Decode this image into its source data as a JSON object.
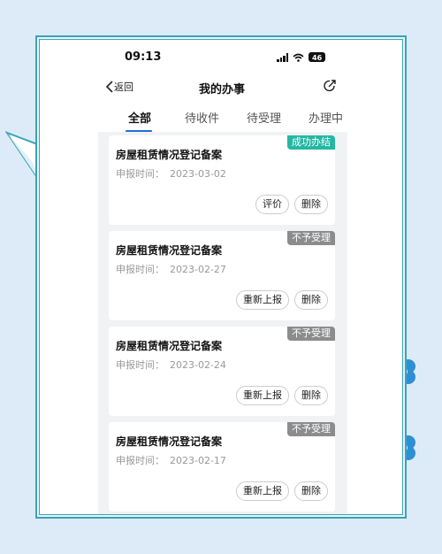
{
  "statusbar": {
    "time": "09:13",
    "battery": "46"
  },
  "navbar": {
    "back_label": "返回",
    "title": "我的办事"
  },
  "tabs": [
    {
      "label": "全部",
      "active": true
    },
    {
      "label": "待收件",
      "active": false
    },
    {
      "label": "待受理",
      "active": false
    },
    {
      "label": "办理中",
      "active": false
    }
  ],
  "colors": {
    "accent": "#1f6fd8",
    "success": "#25b7a3",
    "rejected": "#8c8c8c",
    "frame": "#3aa3b5"
  },
  "cards": [
    {
      "title": "房屋租赁情况登记备案",
      "date_label": "申报时间：",
      "date": "2023-03-02",
      "status": "成功办结",
      "status_color": "#25b7a3",
      "buttons": [
        "评价",
        "删除"
      ]
    },
    {
      "title": "房屋租赁情况登记备案",
      "date_label": "申报时间：",
      "date": "2023-02-27",
      "status": "不予受理",
      "status_color": "#8c8c8c",
      "buttons": [
        "重新上报",
        "删除"
      ]
    },
    {
      "title": "房屋租赁情况登记备案",
      "date_label": "申报时间：",
      "date": "2023-02-24",
      "status": "不予受理",
      "status_color": "#8c8c8c",
      "buttons": [
        "重新上报",
        "删除"
      ]
    },
    {
      "title": "房屋租赁情况登记备案",
      "date_label": "申报时间：",
      "date": "2023-02-17",
      "status": "不予受理",
      "status_color": "#8c8c8c",
      "buttons": [
        "重新上报",
        "删除"
      ]
    }
  ]
}
